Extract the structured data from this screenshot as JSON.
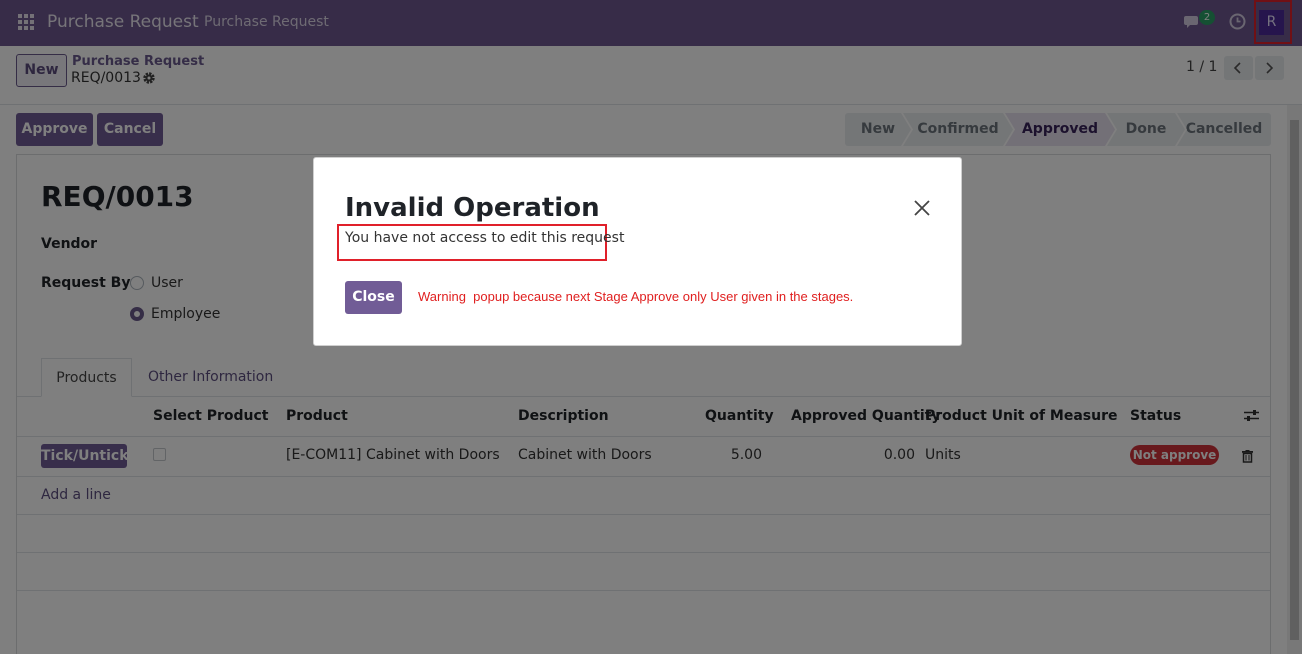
{
  "navbar": {
    "app_title": "Purchase Request",
    "menu_item": "Purchase Request",
    "chat_badge": "2",
    "avatar_letter": "R",
    "icons": [
      "apps-grid-icon",
      "chat-icon",
      "clock-icon"
    ]
  },
  "control": {
    "new_label": "New",
    "breadcrumb_parent": "Purchase Request",
    "breadcrumb_current": "REQ/0013",
    "pager": "1 / 1"
  },
  "actions": {
    "approve_label": "Approve",
    "cancel_label": "Cancel"
  },
  "stages": [
    {
      "label": "New",
      "active": false
    },
    {
      "label": "Confirmed",
      "active": false
    },
    {
      "label": "Approved",
      "active": true
    },
    {
      "label": "Done",
      "active": false
    },
    {
      "label": "Cancelled",
      "active": false
    }
  ],
  "form": {
    "record_name": "REQ/0013",
    "vendor_label": "Vendor",
    "request_by_label": "Request By",
    "request_by_options": [
      {
        "label": "User",
        "selected": false
      },
      {
        "label": "Employee",
        "selected": true
      }
    ]
  },
  "tabs": [
    {
      "label": "Products",
      "active": true
    },
    {
      "label": "Other Information",
      "active": false
    }
  ],
  "table": {
    "headers": [
      "Select Product",
      "Product",
      "Description",
      "Quantity",
      "Approved Quantity",
      "Product Unit of Measure",
      "Status"
    ],
    "rows": [
      {
        "tick_label": "Tick/Untick",
        "selected": false,
        "product": "[E-COM11] Cabinet with Doors",
        "description": "Cabinet with Doors",
        "quantity": "5.00",
        "approved_quantity": "0.00",
        "uom": "Units",
        "status": "Not approve"
      }
    ],
    "add_line_label": "Add a line"
  },
  "dialog": {
    "title": "Invalid Operation",
    "message": "You have not access to edit this request",
    "close_label": "Close",
    "annotation": "Warning  popup because next Stage Approve only User given in the stages."
  },
  "colors": {
    "navbar": "#6e5890",
    "primary": "#715c96",
    "annotation": "#e02020",
    "status_badge": "#d0323a"
  }
}
